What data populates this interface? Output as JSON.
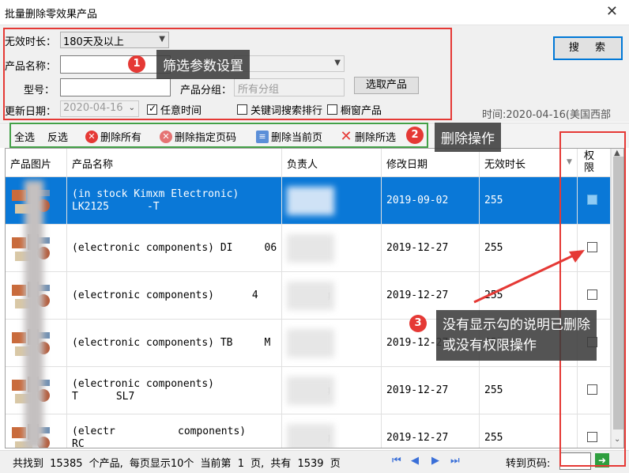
{
  "window": {
    "title": "批量删除零效果产品",
    "close_glyph": "✕"
  },
  "filters": {
    "invalid_duration_label": "无效时长：",
    "invalid_duration_value": "180天及以上",
    "product_name_label": "产品名称：",
    "model_label": "型号：",
    "category_label": "产品分组：",
    "category_placeholder": "所有分组",
    "select_product_button": "选取产品",
    "update_date_label": "更新日期：",
    "update_date_value": "2020-04-16",
    "any_time_label": "任意时间",
    "keyword_rank_label": "关键词搜索排行",
    "showcase_label": "橱窗产品",
    "search_button": "搜 索",
    "time_text": "时间:2020-04-16(美国西部"
  },
  "annotations": {
    "badge1": "1",
    "tip1": "筛选参数设置",
    "badge2": "2",
    "tip2": "删除操作",
    "badge3": "3",
    "tip3_line1": "没有显示勾的说明已删除",
    "tip3_line2": "或没有权限操作"
  },
  "toolbar": {
    "select_all": "全选",
    "invert": "反选",
    "delete_all": "删除所有",
    "delete_pages": "删除指定页码",
    "delete_current": "删除当前页",
    "delete_selected": "删除所选"
  },
  "grid": {
    "headers": [
      "产品图片",
      "产品名称",
      "负责人",
      "修改日期",
      "无效时长",
      "权限"
    ],
    "rows": [
      {
        "name1": "(in stock Kimxm Electronic)",
        "name2": "LK2125",
        "name2_tail": "-T",
        "owner": "",
        "date": "2019-09-02",
        "duration": "255",
        "selected": true
      },
      {
        "name1": "(electronic components) DI",
        "name1_tail": "06",
        "name2": "",
        "owner": "zy",
        "date": "2019-12-27",
        "duration": "255",
        "selected": false
      },
      {
        "name1": "(electronic components)  ",
        "name1_tail": "4",
        "name2": "",
        "owner": "zy   g",
        "date": "2019-12-27",
        "duration": "255",
        "selected": false
      },
      {
        "name1": "(electronic components) TB",
        "name1_tail": "M",
        "name2": "",
        "owner": "zy",
        "date": "2019-12-27",
        "duration": "255",
        "selected": false
      },
      {
        "name1": "(electronic components)",
        "name2": "T",
        "name2_tail": "SL7",
        "owner": "zy   g",
        "date": "2019-12-27",
        "duration": "255",
        "selected": false
      },
      {
        "name1": "(electr",
        "name1_tail": "components)",
        "name2": "RC",
        "owner": "zy   g",
        "date": "2019-12-27",
        "duration": "255",
        "selected": false
      }
    ]
  },
  "status": {
    "info": "共找到 15385 个产品, 每页显示10个 当前第 1 页, 共有 1539 页",
    "goto_label": "转到页码:",
    "go_glyph": "➜"
  },
  "colors": {
    "accent": "#0a78d7",
    "annotation_red": "#e53935",
    "annotation_green": "#43a047"
  }
}
